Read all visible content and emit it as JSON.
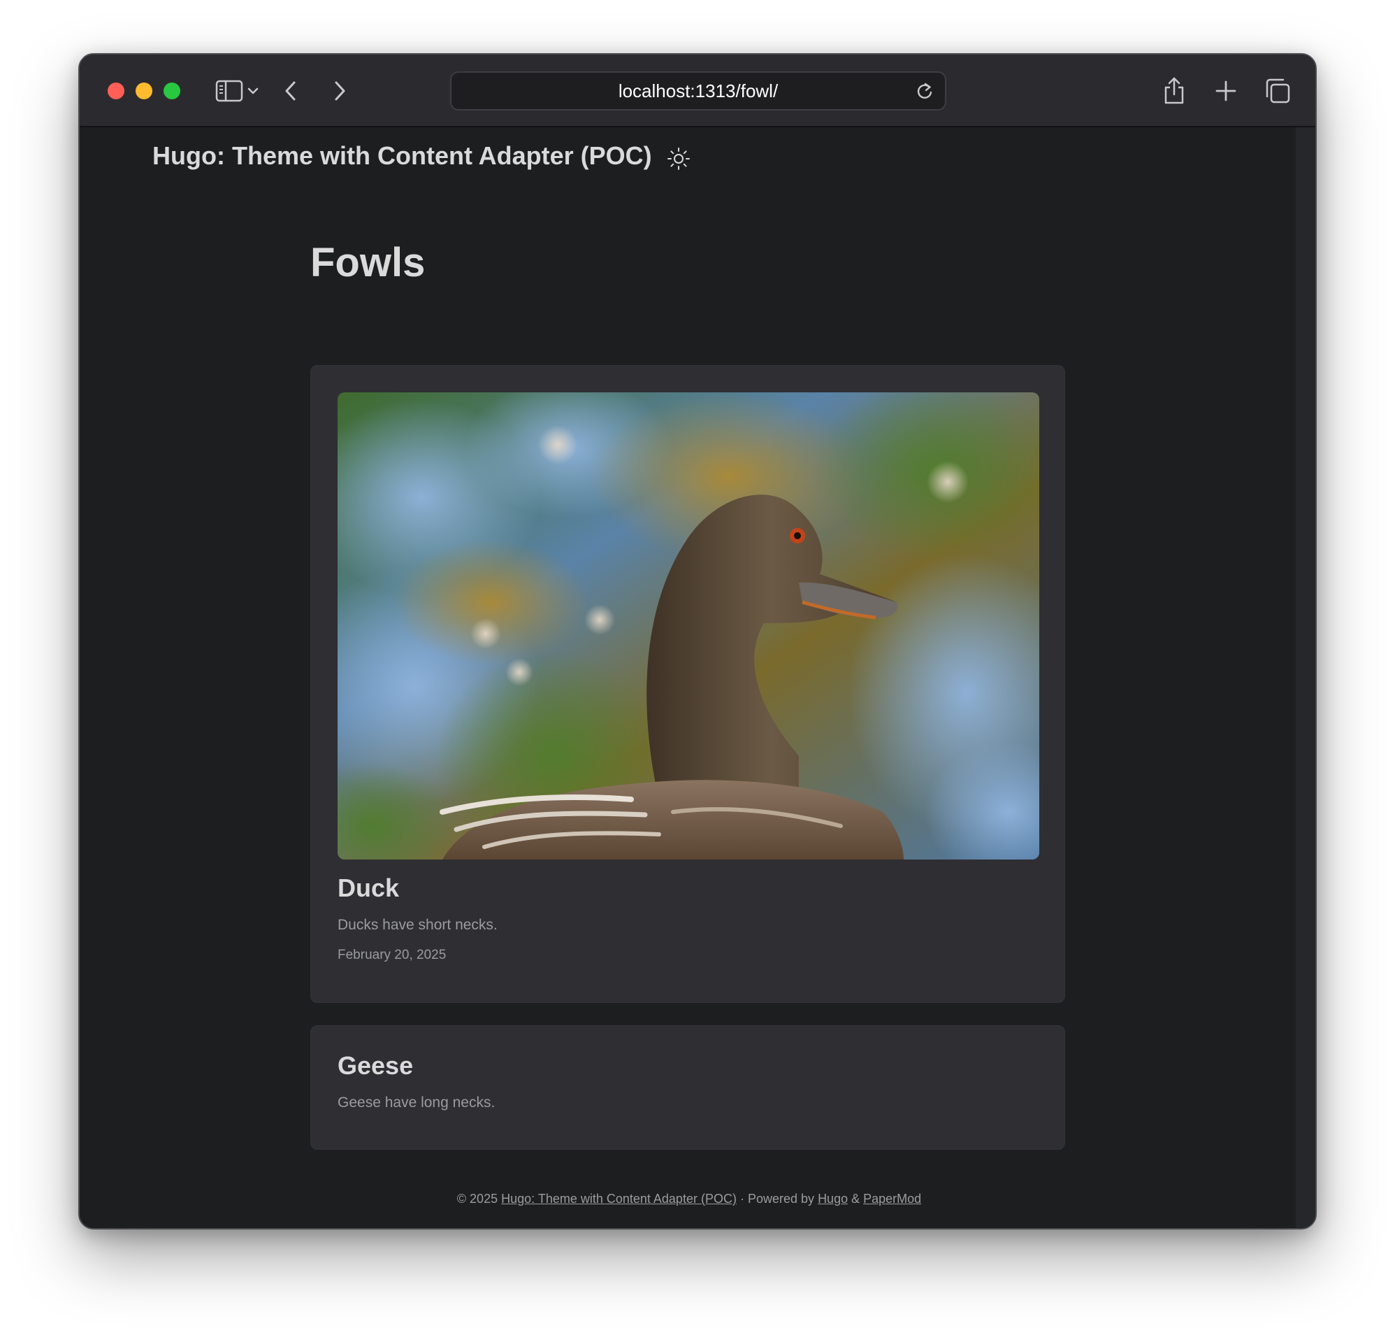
{
  "browser": {
    "url": "localhost:1313/fowl/",
    "icons": {
      "sidebar": "sidebar-icon",
      "dropdown": "chevron-down-icon",
      "back": "back-icon",
      "forward": "forward-icon",
      "reload": "reload-icon",
      "share": "share-icon",
      "new_tab": "plus-icon",
      "tabs": "tabs-overview-icon"
    }
  },
  "site": {
    "title": "Hugo: Theme with Content Adapter (POC)",
    "theme_toggle_icon": "sun-icon"
  },
  "page": {
    "heading": "Fowls"
  },
  "posts": [
    {
      "title": "Duck",
      "summary": "Ducks have short necks.",
      "date": "February 20, 2025",
      "cover": "duck-photo"
    },
    {
      "title": "Geese",
      "summary": "Geese have long necks."
    }
  ],
  "footer": {
    "copyright": "© 2025",
    "site_link": "Hugo: Theme with Content Adapter (POC)",
    "separator": "·",
    "powered_by": "Powered by",
    "hugo_link": "Hugo",
    "amp": "&",
    "papermod_link": "PaperMod"
  },
  "colors": {
    "page_bg": "#1d1e20",
    "card_bg": "#2e2e33",
    "text_primary": "#dadadb",
    "text_secondary": "#9b9c9d"
  }
}
